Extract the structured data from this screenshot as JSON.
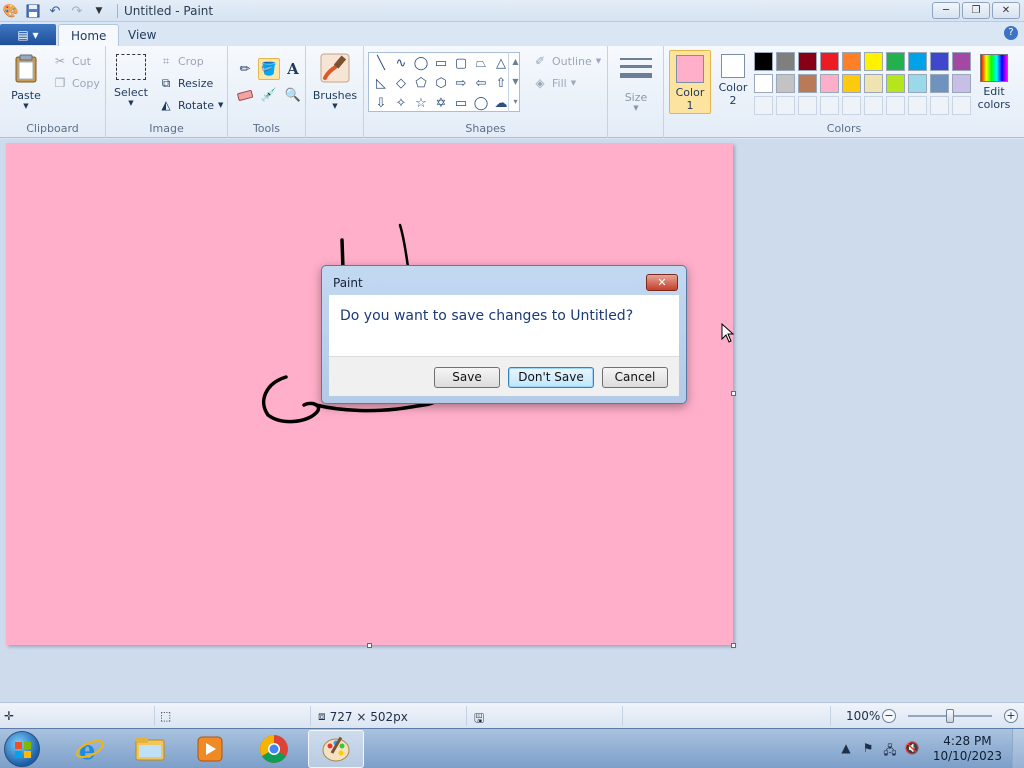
{
  "window": {
    "title": "Untitled - Paint",
    "controls": {
      "minimize": "─",
      "restore": "❐",
      "close": "✕"
    }
  },
  "ribbon_tabs": [
    "Home",
    "View"
  ],
  "clipboard": {
    "paste": "Paste",
    "cut": "Cut",
    "copy": "Copy",
    "label": "Clipboard"
  },
  "image_group": {
    "select": "Select",
    "crop": "Crop",
    "resize": "Resize",
    "rotate": "Rotate",
    "label": "Image"
  },
  "tools_group": {
    "label": "Tools",
    "brushes": "Brushes"
  },
  "shapes_group": {
    "outline": "Outline",
    "fill": "Fill",
    "label": "Shapes"
  },
  "size_group": {
    "label": "Size"
  },
  "colors_group": {
    "color1": {
      "line1": "Color",
      "line2": "1",
      "value": "#ffafc9"
    },
    "color2": {
      "line1": "Color",
      "line2": "2",
      "value": "#ffffff"
    },
    "edit": {
      "line1": "Edit",
      "line2": "colors"
    },
    "label": "Colors",
    "palette_row1": [
      "#000000",
      "#7f7f7f",
      "#880015",
      "#ed1c24",
      "#ff7f27",
      "#fff200",
      "#22b14c",
      "#00a2e8",
      "#3f48cc",
      "#a349a4"
    ],
    "palette_row2": [
      "#ffffff",
      "#c3c3c3",
      "#b97a57",
      "#ffaec9",
      "#ffc90e",
      "#efe4b0",
      "#b5e61d",
      "#99d9ea",
      "#7092be",
      "#c8bfe7"
    ]
  },
  "canvas": {
    "background": "#ffafc9"
  },
  "dialog": {
    "title": "Paint",
    "message": "Do you want to save changes to Untitled?",
    "buttons": {
      "save": "Save",
      "dont_save": "Don't Save",
      "cancel": "Cancel"
    }
  },
  "statusbar": {
    "canvas_size": "727 × 502px",
    "zoom": "100%",
    "zoom_out": "−",
    "zoom_in": "+",
    "zoom_level": 0.5
  },
  "taskbar": {
    "time": "4:28 PM",
    "date": "10/10/2023"
  }
}
